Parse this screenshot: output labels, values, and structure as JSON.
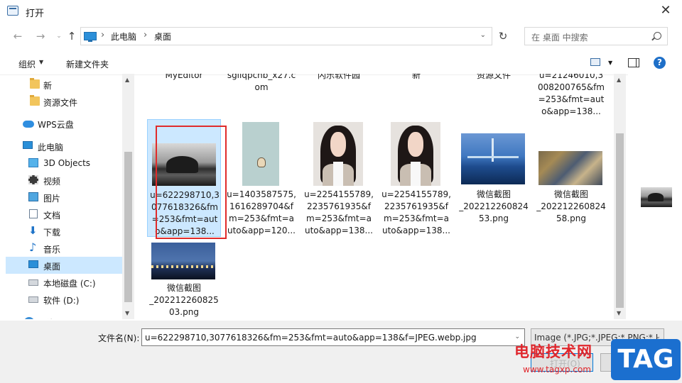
{
  "window": {
    "title": "打开",
    "close_glyph": "✕"
  },
  "nav": {
    "back": "←",
    "forward": "→",
    "up": "↑",
    "dropdown": "⌄"
  },
  "address": {
    "crumbs": [
      "此电脑",
      "桌面"
    ],
    "sep": "›",
    "refresh": "↻",
    "dropdown": "⌄"
  },
  "search": {
    "placeholder": "在 桌面 中搜索"
  },
  "toolbar": {
    "organize": "组织",
    "organize_caret": "▼",
    "new_folder": "新建文件夹",
    "view_caret": "▼",
    "help": "?"
  },
  "sidebar": {
    "items": [
      {
        "label": "新",
        "icon": "folder-icon"
      },
      {
        "label": "资源文件",
        "icon": "folder-icon"
      },
      {
        "label": "WPS云盘",
        "icon": "cloud-icon"
      },
      {
        "label": "此电脑",
        "icon": "monitor-icon"
      },
      {
        "label": "3D Objects",
        "icon": "cube-icon"
      },
      {
        "label": "视频",
        "icon": "film-icon"
      },
      {
        "label": "图片",
        "icon": "picture-icon"
      },
      {
        "label": "文档",
        "icon": "document-icon"
      },
      {
        "label": "下载",
        "icon": "download-icon"
      },
      {
        "label": "音乐",
        "icon": "music-icon"
      },
      {
        "label": "桌面",
        "icon": "desktop-icon"
      },
      {
        "label": "本地磁盘 (C:)",
        "icon": "drive-icon"
      },
      {
        "label": "软件 (D:)",
        "icon": "drive-icon"
      },
      {
        "label": "网络",
        "icon": "network-icon"
      }
    ],
    "scroll_up": "▲",
    "scroll_down": "▼"
  },
  "files": {
    "cut_row": [
      "MyEditor",
      "sgliqpchb_x27.c\nom",
      "闪乐软件园",
      "新",
      "资源文件",
      "u=21246010,3\n008200765&fm\n=253&fmt=aut\no&app=138..."
    ],
    "items": [
      {
        "name": "u=622298710,3\n077618326&fm\n=253&fmt=aut\no&app=138...",
        "thumb": "mountain-photo"
      },
      {
        "name": "u=1403587575,\n1616289704&f\nm=253&fmt=a\nuto&app=120...",
        "thumb": "dog-photo"
      },
      {
        "name": "u=2254155789,\n2235761935&f\nm=253&fmt=a\nuto&app=138...",
        "thumb": "portrait-photo"
      },
      {
        "name": "u=2254155789,\n2235761935&f\nm=253&fmt=a\nuto&app=138...",
        "thumb": "portrait-photo"
      },
      {
        "name": "微信截图\n_202212260824\n53.png",
        "thumb": "bridge-photo"
      },
      {
        "name": "微信截图\n_202212260824\n58.png",
        "thumb": "city-photo"
      },
      {
        "name": "微信截图\n_202212260825\n03.png",
        "thumb": "night-photo"
      }
    ],
    "scroll_up": "▲",
    "scroll_down": "▼"
  },
  "bottom": {
    "filename_label": "文件名(N):",
    "filename_value": "u=622298710,3077618326&fm=253&fmt=auto&app=138&f=JPEG.webp.jpg",
    "filter_value": "Image (*.JPG;*.JPEG;*.PNG;*.I",
    "open_label": "打开(O)",
    "dropdown": "⌄"
  },
  "watermark": {
    "site_cn": "电脑技术网",
    "url": "www.tagxp.com",
    "tag": "TAG"
  },
  "colors": {
    "selection": "#cce8ff",
    "highlight_box": "#e02b2b",
    "accent": "#0078d7"
  }
}
